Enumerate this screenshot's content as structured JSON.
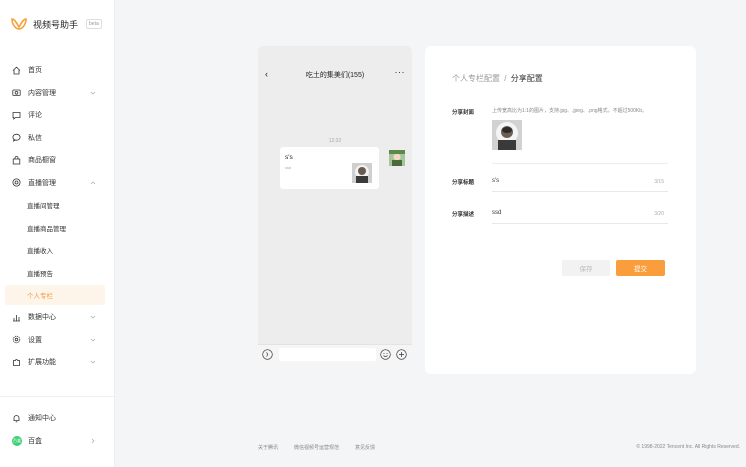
{
  "app": {
    "name": "视频号助手",
    "badge": "beta",
    "accent": "#fa9d3b"
  },
  "sidebar": {
    "items": [
      {
        "label": "首页",
        "icon": "home-icon"
      },
      {
        "label": "内容管理",
        "icon": "camera-icon",
        "expandable": true
      },
      {
        "label": "评论",
        "icon": "comment-icon"
      },
      {
        "label": "私信",
        "icon": "message-icon"
      },
      {
        "label": "商品橱窗",
        "icon": "bag-icon"
      },
      {
        "label": "直播管理",
        "icon": "live-icon",
        "expandable": true
      }
    ],
    "live_sub": [
      "直播间管理",
      "直播商品管理",
      "直播收入",
      "直播预告",
      "个人专栏"
    ],
    "items2": [
      {
        "label": "数据中心",
        "icon": "chart-icon"
      },
      {
        "label": "设置",
        "icon": "gear-icon"
      },
      {
        "label": "扩展功能",
        "icon": "puzzle-icon"
      }
    ],
    "notify": "通知中心",
    "user": {
      "name": "百盒",
      "avatar_text": "百盒"
    }
  },
  "phone": {
    "title": "吃土的集美们(155)",
    "time": "12:32",
    "card": {
      "title": "s's",
      "desc": "ssd"
    }
  },
  "panel": {
    "crumb_parent": "个人专栏配置",
    "crumb_sep": "/",
    "crumb_current": "分享配置",
    "cover_label": "分享封面",
    "cover_hint": "上传宽高比为1:1的图片，支持.jpg、.jpeg、.png格式，不超过500Kb。",
    "title_label": "分享标题",
    "title_value": "s's",
    "title_count": "3/15",
    "desc_label": "分享描述",
    "desc_value": "ssd",
    "desc_count": "3/20",
    "save_label": "保存",
    "submit_label": "提交"
  },
  "footer": {
    "links": [
      "关于腾讯",
      "微信视频号运营规范",
      "意见反馈"
    ],
    "copyright": "© 1998-2022 Tencent Inc. All Rights Reserved."
  }
}
